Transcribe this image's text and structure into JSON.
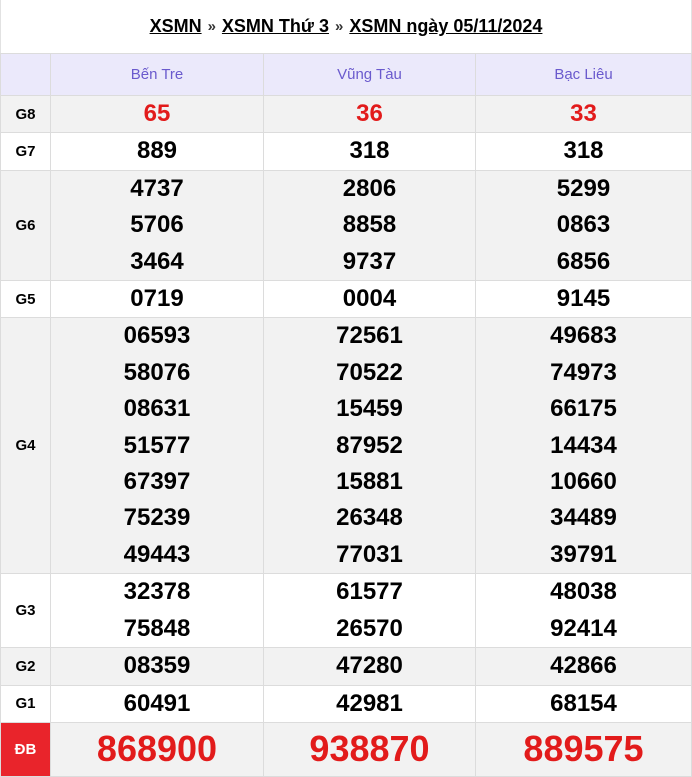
{
  "breadcrumb": {
    "items": [
      "XSMN",
      "XSMN Thứ 3",
      "XSMN ngày 05/11/2024"
    ],
    "separator": "»"
  },
  "colors": {
    "header_bg": "#ebe9fb",
    "header_text": "#6a5acd",
    "accent_red": "#e21b1b",
    "db_label_bg": "#e9242b",
    "row_shade": "#f2f2f2"
  },
  "provinces": [
    "Bến Tre",
    "Vũng Tàu",
    "Bạc Liêu"
  ],
  "prizes": [
    {
      "label": "G8",
      "style": "red",
      "values": [
        [
          "65"
        ],
        [
          "36"
        ],
        [
          "33"
        ]
      ]
    },
    {
      "label": "G7",
      "style": "normal",
      "values": [
        [
          "889"
        ],
        [
          "318"
        ],
        [
          "318"
        ]
      ]
    },
    {
      "label": "G6",
      "style": "normal",
      "values": [
        [
          "4737",
          "5706",
          "3464"
        ],
        [
          "2806",
          "8858",
          "9737"
        ],
        [
          "5299",
          "0863",
          "6856"
        ]
      ]
    },
    {
      "label": "G5",
      "style": "normal",
      "values": [
        [
          "0719"
        ],
        [
          "0004"
        ],
        [
          "9145"
        ]
      ]
    },
    {
      "label": "G4",
      "style": "normal",
      "values": [
        [
          "06593",
          "58076",
          "08631",
          "51577",
          "67397",
          "75239",
          "49443"
        ],
        [
          "72561",
          "70522",
          "15459",
          "87952",
          "15881",
          "26348",
          "77031"
        ],
        [
          "49683",
          "74973",
          "66175",
          "14434",
          "10660",
          "34489",
          "39791"
        ]
      ]
    },
    {
      "label": "G3",
      "style": "normal",
      "values": [
        [
          "32378",
          "75848"
        ],
        [
          "61577",
          "26570"
        ],
        [
          "48038",
          "92414"
        ]
      ]
    },
    {
      "label": "G2",
      "style": "normal",
      "values": [
        [
          "08359"
        ],
        [
          "47280"
        ],
        [
          "42866"
        ]
      ]
    },
    {
      "label": "G1",
      "style": "normal",
      "values": [
        [
          "60491"
        ],
        [
          "42981"
        ],
        [
          "68154"
        ]
      ]
    },
    {
      "label": "ĐB",
      "style": "big",
      "values": [
        [
          "868900"
        ],
        [
          "938870"
        ],
        [
          "889575"
        ]
      ]
    }
  ]
}
